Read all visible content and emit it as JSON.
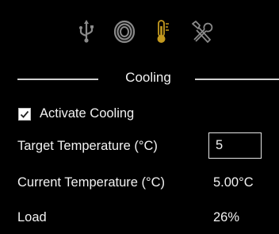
{
  "toolbar": {
    "icons": [
      "usb-icon",
      "cable-coil-icon",
      "thermometer-icon",
      "tools-icon"
    ],
    "active_color": "#c49a1f",
    "inactive_color": "#8a8a8a"
  },
  "cooling": {
    "section_title": "Cooling",
    "activate_label": "Activate Cooling",
    "activate_checked": true,
    "target_label": "Target Temperature (°C)",
    "target_value": "5",
    "current_label": "Current Temperature (°C)",
    "current_value": "5.00°C",
    "load_label": "Load",
    "load_value": "26%"
  }
}
